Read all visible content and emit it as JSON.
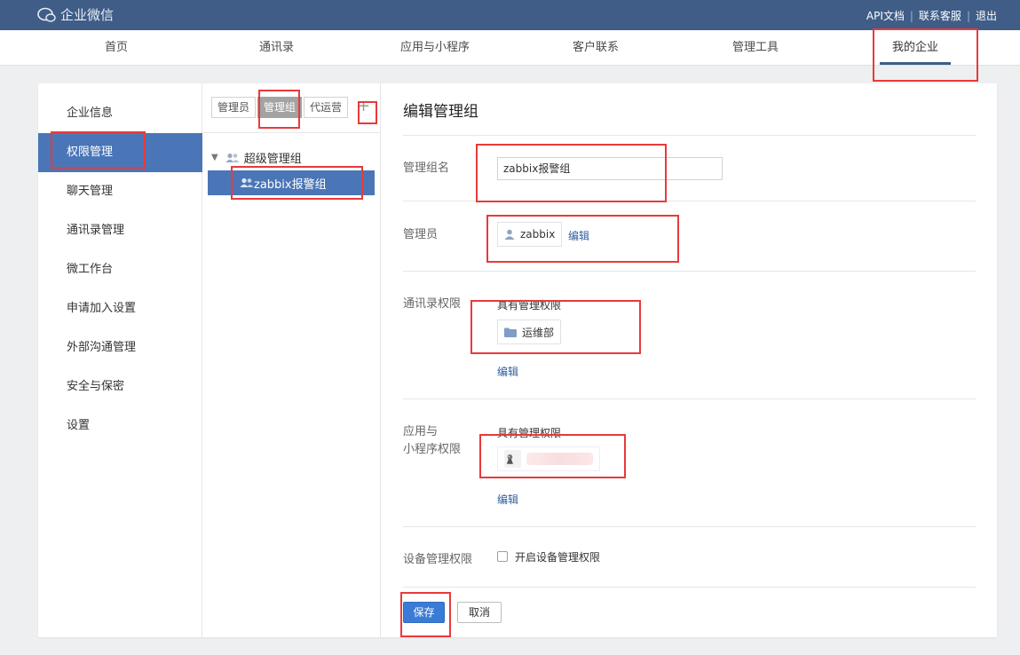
{
  "topbar": {
    "logo_text": "企业微信",
    "links": [
      {
        "label": "API文档"
      },
      {
        "label": "联系客服"
      },
      {
        "label": "退出"
      }
    ]
  },
  "nav": {
    "items": [
      {
        "label": "首页"
      },
      {
        "label": "通讯录"
      },
      {
        "label": "应用与小程序"
      },
      {
        "label": "客户联系"
      },
      {
        "label": "管理工具"
      },
      {
        "label": "我的企业",
        "active": true
      }
    ]
  },
  "sidebar": {
    "items": [
      {
        "label": "企业信息"
      },
      {
        "label": "权限管理",
        "active": true
      },
      {
        "label": "聊天管理"
      },
      {
        "label": "通讯录管理"
      },
      {
        "label": "微工作台"
      },
      {
        "label": "申请加入设置"
      },
      {
        "label": "外部沟通管理"
      },
      {
        "label": "安全与保密"
      },
      {
        "label": "设置"
      }
    ]
  },
  "groups": {
    "tabs": [
      {
        "label": "管理员"
      },
      {
        "label": "管理组",
        "active": true
      },
      {
        "label": "代运营"
      }
    ],
    "add_symbol": "+",
    "root": "超级管理组",
    "selected": "zabbix报警组"
  },
  "form": {
    "title": "编辑管理组",
    "name_label": "管理组名",
    "name_value": "zabbix报警组",
    "admin_label": "管理员",
    "admin_name": "zabbix",
    "edit_link": "编辑",
    "contacts_label": "通讯录权限",
    "contacts_perm": "具有管理权限",
    "department": "运维部",
    "apps_label_line1": "应用与",
    "apps_label_line2": "小程序权限",
    "apps_perm": "具有管理权限",
    "device_label": "设备管理权限",
    "device_checkbox_label": "开启设备管理权限",
    "device_checked": false,
    "save": "保存",
    "cancel": "取消"
  },
  "colors": {
    "topbar": "#3f5d87",
    "accent": "#4a76b8",
    "highlight": "#e83a3a",
    "link": "#2f5e9e"
  }
}
